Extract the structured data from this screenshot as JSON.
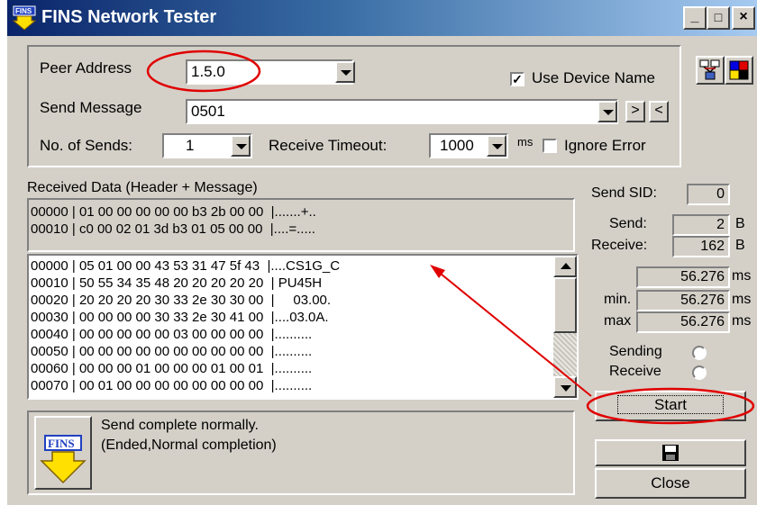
{
  "window": {
    "title": "FINS Network Tester",
    "controls": [
      "_",
      "□",
      "×"
    ]
  },
  "settings": {
    "peer_address_label": "Peer Address",
    "peer_address_value": "1.5.0",
    "use_device_name_label": "Use Device Name",
    "use_device_name_checked": true,
    "send_message_label": "Send Message",
    "send_message_value": "0501",
    "next_label": ">",
    "prev_label": "<",
    "sends_label": "No. of Sends:",
    "sends_value": "1",
    "timeout_label": "Receive Timeout:",
    "timeout_value": "1000",
    "timeout_unit": "ms",
    "ignore_error_label": "Ignore Error"
  },
  "received": {
    "label": "Received Data (Header + Message)",
    "header_lines": [
      "00000 | 01 00 00 00 00 00 b3 2b 00 00  |.......+..",
      "00010 | c0 00 02 01 3d b3 01 05 00 00  |....=....."
    ],
    "message_lines": [
      "00000 | 05 01 00 00 43 53 31 47 5f 43  |....CS1G_C",
      "00010 | 50 55 34 35 48 20 20 20 20 20  | PU45H",
      "00020 | 20 20 20 20 30 33 2e 30 30 00  |     03.00.",
      "00030 | 00 00 00 00 30 33 2e 30 41 00  |....03.0A.",
      "00040 | 00 00 00 00 00 03 00 00 00 00  |..........",
      "00050 | 00 00 00 00 00 00 00 00 00 00  |..........",
      "00060 | 00 00 00 01 00 00 00 01 00 01  |..........",
      "00070 | 00 01 00 00 00 00 00 00 00 00  |.........."
    ]
  },
  "status": {
    "badge": "FINS",
    "line1": "Send complete normally.",
    "line2": "(Ended,Normal completion)"
  },
  "stats": {
    "send_sid_label": "Send SID:",
    "send_sid_value": "0",
    "send_label": "Send:",
    "send_value": "2",
    "send_unit": "B",
    "receive_label": "Receive:",
    "receive_value": "162",
    "receive_unit": "B",
    "time_value": "56.276",
    "min_label": "min.",
    "min_value": "56.276",
    "max_label": "max",
    "max_value": "56.276",
    "ms_unit": "ms",
    "sending_label": "Sending",
    "receive_status_label": "Receive"
  },
  "buttons": {
    "start": "Start",
    "close": "Close"
  },
  "colors": {
    "title_start": "#0a246a",
    "title_end": "#a6caf0",
    "annotation_red": "#e00000",
    "face": "#d4d0c8"
  },
  "icons": [
    "app-icon",
    "network-icon",
    "palette-icon",
    "save-icon",
    "fins-arrow-icon"
  ]
}
